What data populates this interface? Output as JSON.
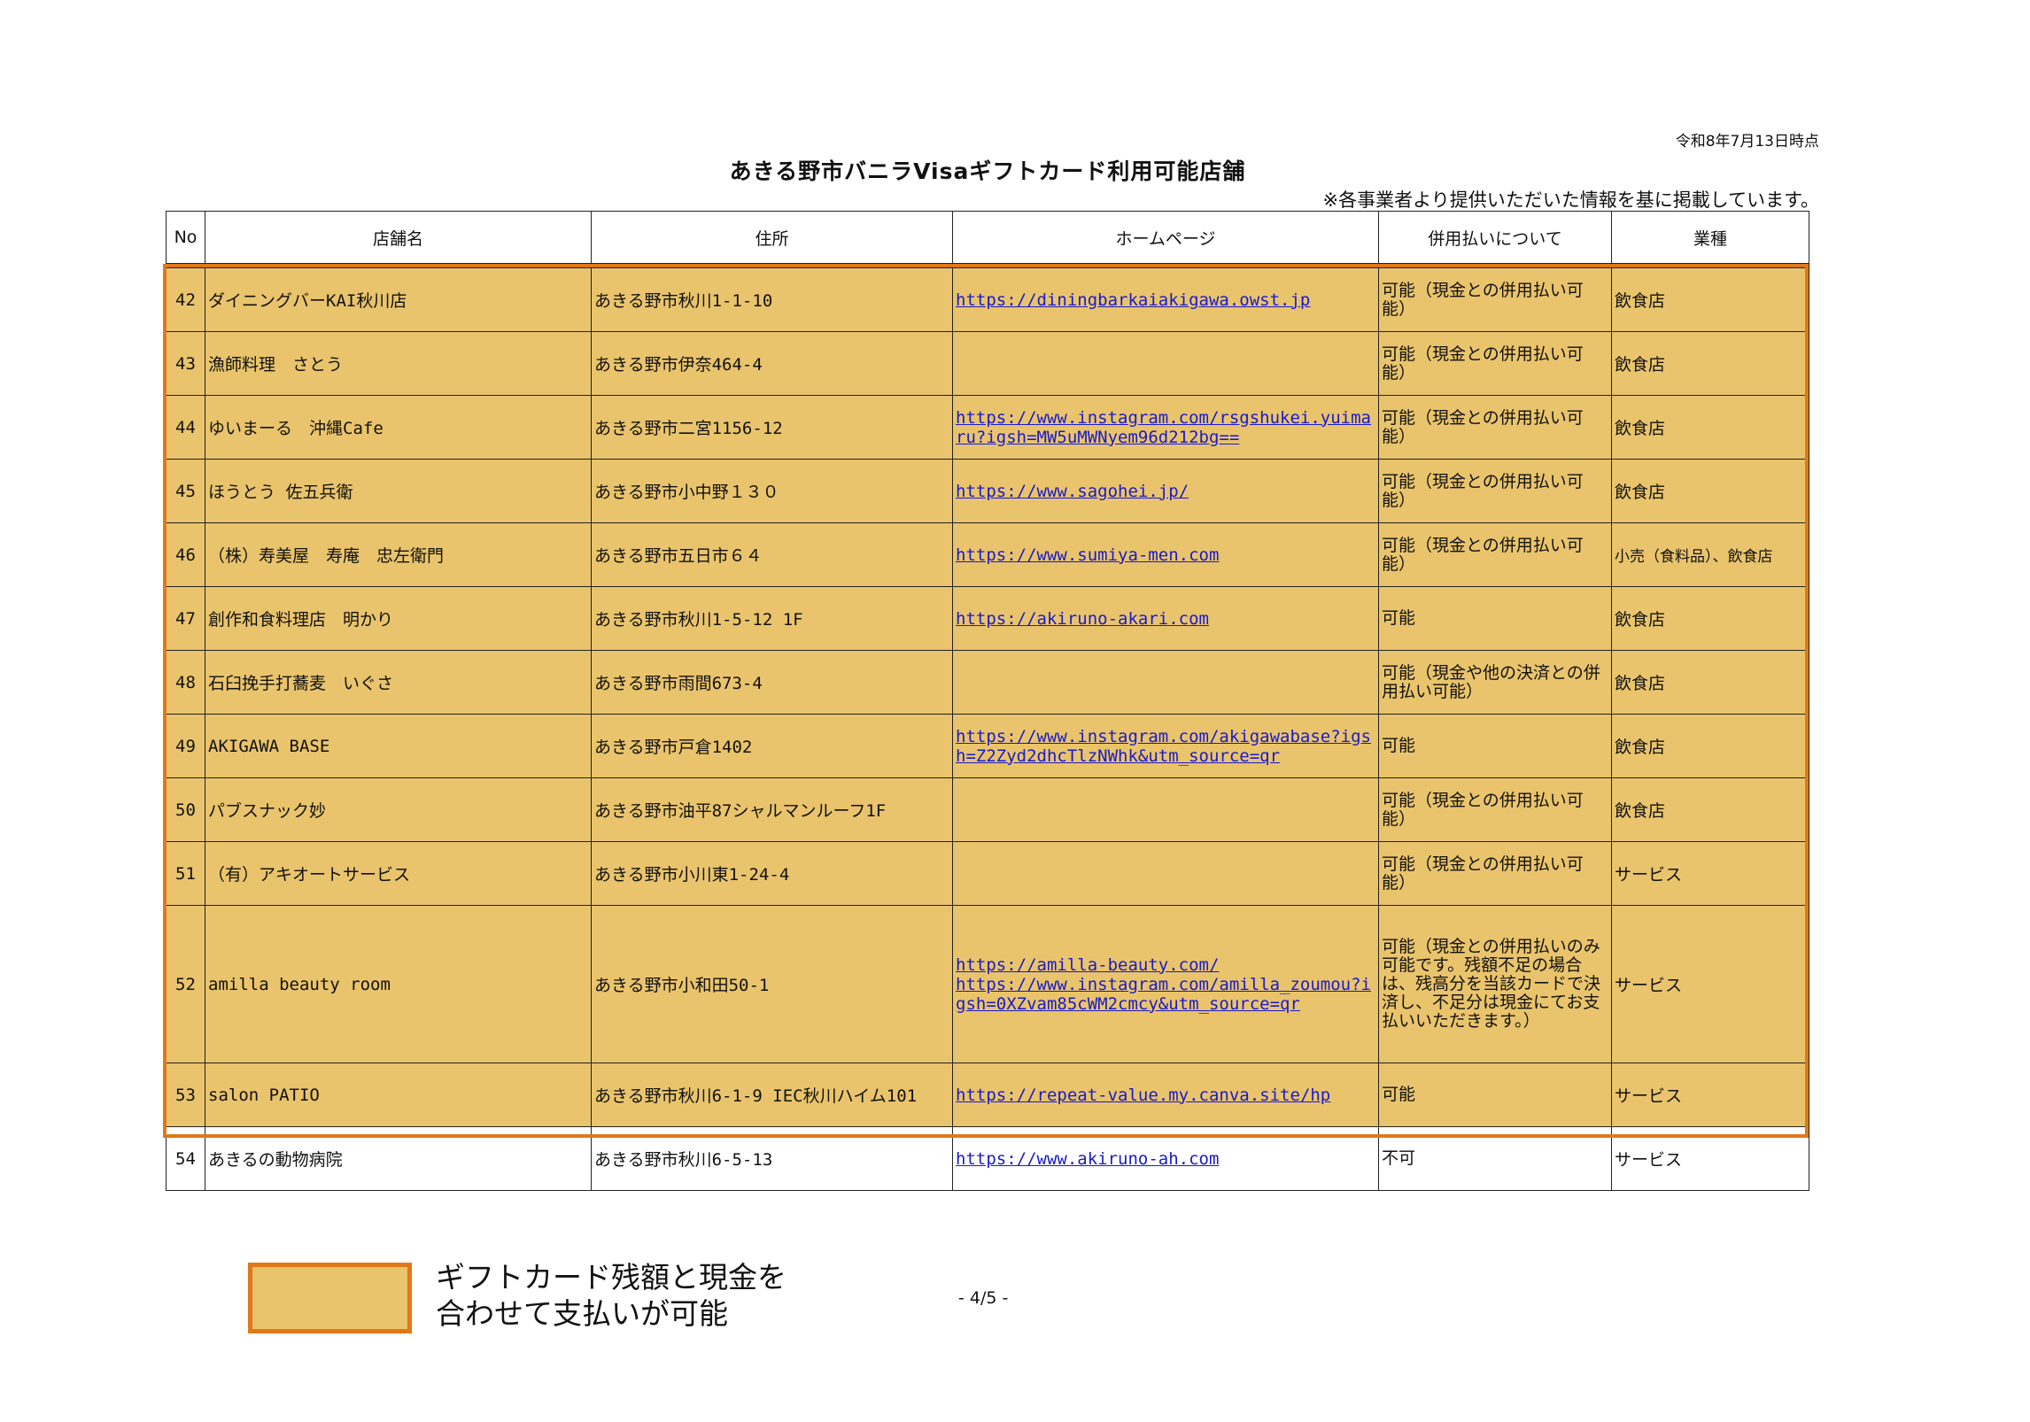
{
  "header": {
    "date": "令和8年7月13日時点",
    "title": "あきる野市バニラVisaギフトカード利用可能店舗",
    "note": "※各事業者より提供いただいた情報を基に掲載しています。"
  },
  "table": {
    "columns": [
      "No",
      "店舗名",
      "住所",
      "ホームページ",
      "併用払いについて",
      "業種"
    ],
    "rows": [
      {
        "no": "42",
        "name": "ダイニングバーKAI秋川店",
        "address": "あきる野市秋川1-1-10",
        "links": [
          "https://diningbarkaiakigawa.owst.jp"
        ],
        "payment": "可能（現金との併用払い可能）",
        "kind": "飲食店"
      },
      {
        "no": "43",
        "name": "漁師料理　さとう",
        "address": "あきる野市伊奈464-4",
        "links": [],
        "payment": "可能（現金との併用払い可能）",
        "kind": "飲食店"
      },
      {
        "no": "44",
        "name": "ゆいまーる　沖縄Cafe",
        "address": "あきる野市二宮1156-12",
        "links": [
          "https://www.instagram.com/rsgshukei.yuimaru?igsh=MW5uMWNyem96d212bg=="
        ],
        "payment": "可能（現金との併用払い可能）",
        "kind": "飲食店"
      },
      {
        "no": "45",
        "name": "ほうとう 佐五兵衛",
        "address": "あきる野市小中野１３０",
        "links": [
          "https://www.sagohei.jp/"
        ],
        "payment": "可能（現金との併用払い可能）",
        "kind": "飲食店"
      },
      {
        "no": "46",
        "name": "（株）寿美屋　寿庵　忠左衛門",
        "address": "あきる野市五日市６４",
        "links": [
          "https://www.sumiya-men.com"
        ],
        "payment": "可能（現金との併用払い可能）",
        "kind": "小売（食料品）、飲食店"
      },
      {
        "no": "47",
        "name": "創作和食料理店　明かり",
        "address": "あきる野市秋川1-5-12 1F",
        "links": [
          "https://akiruno-akari.com"
        ],
        "payment": "可能",
        "kind": "飲食店"
      },
      {
        "no": "48",
        "name": "石臼挽手打蕎麦　いぐさ",
        "address": "あきる野市雨間673-4",
        "links": [],
        "payment": "可能（現金や他の決済との併用払い可能）",
        "kind": "飲食店"
      },
      {
        "no": "49",
        "name": "AKIGAWA BASE",
        "address": "あきる野市戸倉1402",
        "links": [
          "https://www.instagram.com/akigawabase?igsh=Z2Zyd2dhcTlzNWhk&utm_source=qr"
        ],
        "payment": "可能",
        "kind": "飲食店"
      },
      {
        "no": "50",
        "name": "パブスナック妙",
        "address": "あきる野市油平87シャルマンルーフ1F",
        "links": [],
        "payment": "可能（現金との併用払い可能）",
        "kind": "飲食店"
      },
      {
        "no": "51",
        "name": "（有）アキオートサービス",
        "address": "あきる野市小川東1-24-4",
        "links": [],
        "payment": "可能（現金との併用払い可能）",
        "kind": "サービス"
      },
      {
        "no": "52",
        "name": "amilla beauty room",
        "address": "あきる野市小和田50-1",
        "links": [
          "https://amilla-beauty.com/",
          "https://www.instagram.com/amilla_zoumou?igsh=0XZvam85cWM2cmcy&utm_source=qr"
        ],
        "payment": "可能（現金との併用払いのみ可能です。残額不足の場合は、残高分を当該カードで決済し、不足分は現金にてお支払いいただきます。）",
        "kind": "サービス"
      },
      {
        "no": "53",
        "name": "salon PATIO",
        "address": "あきる野市秋川6-1-9 IEC秋川ハイム101",
        "links": [
          "https://repeat-value.my.canva.site/hp"
        ],
        "payment": "可能",
        "kind": "サービス"
      },
      {
        "no": "54",
        "name": "あきるの動物病院",
        "address": "あきる野市秋川6-5-13",
        "links": [
          "https://www.akiruno-ah.com"
        ],
        "payment": "不可",
        "kind": "サービス"
      }
    ]
  },
  "legend": {
    "line1": "ギフトカード残額と現金を",
    "line2": "合わせて支払いが可能"
  },
  "footer": {
    "page": "- 4/5 -"
  },
  "colors": {
    "highlight_fill": "#e9c46c",
    "highlight_border": "#e07818",
    "link": "#1a1acc"
  }
}
